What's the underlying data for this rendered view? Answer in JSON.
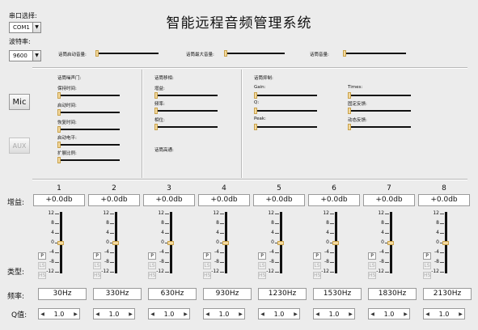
{
  "app": {
    "title": "智能远程音频管理系统"
  },
  "port": {
    "label": "串口选择:",
    "value": "COM1"
  },
  "baud": {
    "label": "波特率:",
    "value": "9600"
  },
  "top_sliders": [
    {
      "label": "话筒启动音量:",
      "value": 0
    },
    {
      "label": "话筒最大音量:",
      "value": 0
    },
    {
      "label": "话筒音量:",
      "value": 0
    }
  ],
  "side_buttons": {
    "mic": "Mic",
    "aux": "AUX"
  },
  "gate": {
    "title": "话筒噪声门:",
    "sliders": [
      {
        "label": "保持时间:",
        "value": 0
      },
      {
        "label": "启动时间:",
        "value": 0
      },
      {
        "label": "恢复时间:",
        "value": 0
      },
      {
        "label": "启动电平:",
        "value": 0
      },
      {
        "label": "扩展比例:",
        "value": 0
      }
    ]
  },
  "shift": {
    "title": "话筒移相:",
    "sliders": [
      {
        "label": "增益:",
        "value": 0
      },
      {
        "label": "频率:",
        "value": 0
      },
      {
        "label": "相位:",
        "value": 0
      }
    ],
    "hp_label": "话筒高通:"
  },
  "suppress": {
    "title": "话筒抑制:",
    "left": [
      {
        "label": "Gain:",
        "value": 0
      },
      {
        "label": "Q:",
        "value": 0
      },
      {
        "label": "Peak:",
        "value": 0
      }
    ],
    "right": [
      {
        "label": "Times:",
        "value": 0
      },
      {
        "label": "固定反馈:",
        "value": 0
      },
      {
        "label": "动态反馈:",
        "value": 0
      }
    ]
  },
  "eq": {
    "gain_label": "增益:",
    "type_label": "类型:",
    "freq_label": "频率:",
    "q_label": "Q值:",
    "scale": [
      "12",
      "8",
      "4",
      "0",
      "-4",
      "-8",
      "-12"
    ],
    "type_options": [
      "P",
      "LS",
      "HS"
    ],
    "channels": [
      {
        "num": "1",
        "gain": "+0.0db",
        "level": 0,
        "freq": "30Hz",
        "q": "1.0"
      },
      {
        "num": "2",
        "gain": "+0.0db",
        "level": 0,
        "freq": "330Hz",
        "q": "1.0"
      },
      {
        "num": "3",
        "gain": "+0.0db",
        "level": 0,
        "freq": "630Hz",
        "q": "1.0"
      },
      {
        "num": "4",
        "gain": "+0.0db",
        "level": 0,
        "freq": "930Hz",
        "q": "1.0"
      },
      {
        "num": "5",
        "gain": "+0.0db",
        "level": 0,
        "freq": "1230Hz",
        "q": "1.0"
      },
      {
        "num": "6",
        "gain": "+0.0db",
        "level": 0,
        "freq": "1530Hz",
        "q": "1.0"
      },
      {
        "num": "7",
        "gain": "+0.0db",
        "level": 0,
        "freq": "1830Hz",
        "q": "1.0"
      },
      {
        "num": "8",
        "gain": "+0.0db",
        "level": 0,
        "freq": "2130Hz",
        "q": "1.0"
      }
    ]
  },
  "icons": {
    "dropdown": "chevron-down-icon",
    "spin_left": "arrow-left-icon",
    "spin_right": "arrow-right-icon"
  }
}
